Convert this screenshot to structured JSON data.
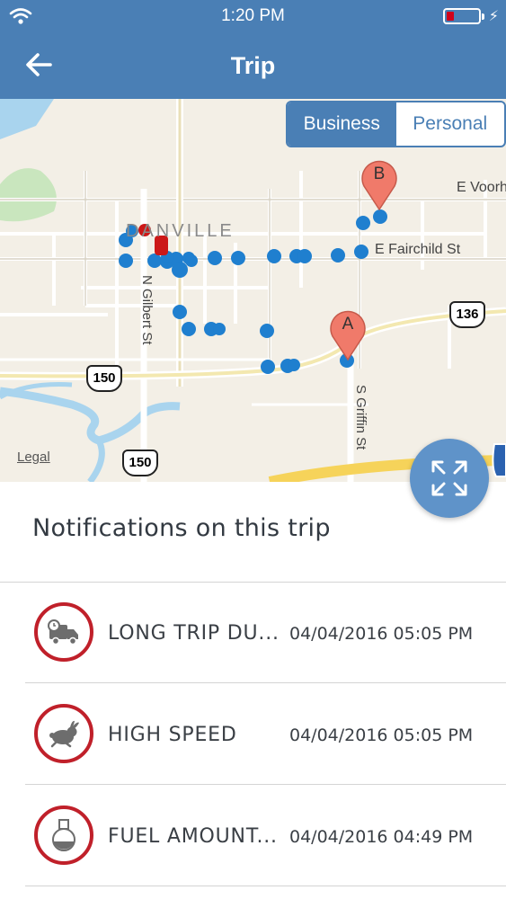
{
  "status_bar": {
    "time": "1:20 PM"
  },
  "header": {
    "title": "Trip"
  },
  "trip_type": {
    "business_label": "Business",
    "personal_label": "Personal",
    "selected": "Business"
  },
  "map": {
    "city_label": "DANVILLE",
    "streets": [
      "E Voorhees",
      "E Fairchild St",
      "N Gilbert St",
      "S Griffin St"
    ],
    "route_shields": [
      "150",
      "150",
      "136"
    ],
    "legal_label": "Legal",
    "marker_start": "A",
    "marker_end": "B",
    "colors": {
      "route_dot": "#1f7fcf",
      "event_dot": "#cc1818",
      "marker": "#f07a6a",
      "water": "#a9d4ee",
      "park": "#c9e6be",
      "highway": "#f6d35a"
    }
  },
  "notifications": {
    "title": "Notifications on this trip",
    "items": [
      {
        "icon": "truck-clock-icon",
        "label": "LONG TRIP DU...",
        "date": "04/04/2016 05:05 PM"
      },
      {
        "icon": "rabbit-icon",
        "label": "HIGH SPEED",
        "date": "04/04/2016 05:05 PM"
      },
      {
        "icon": "fuel-flask-icon",
        "label": "FUEL AMOUNT...",
        "date": "04/04/2016 04:49 PM"
      }
    ]
  },
  "colors": {
    "header": "#4a7fb5",
    "alert_ring": "#c0202a",
    "fab": "#5f93c9"
  }
}
